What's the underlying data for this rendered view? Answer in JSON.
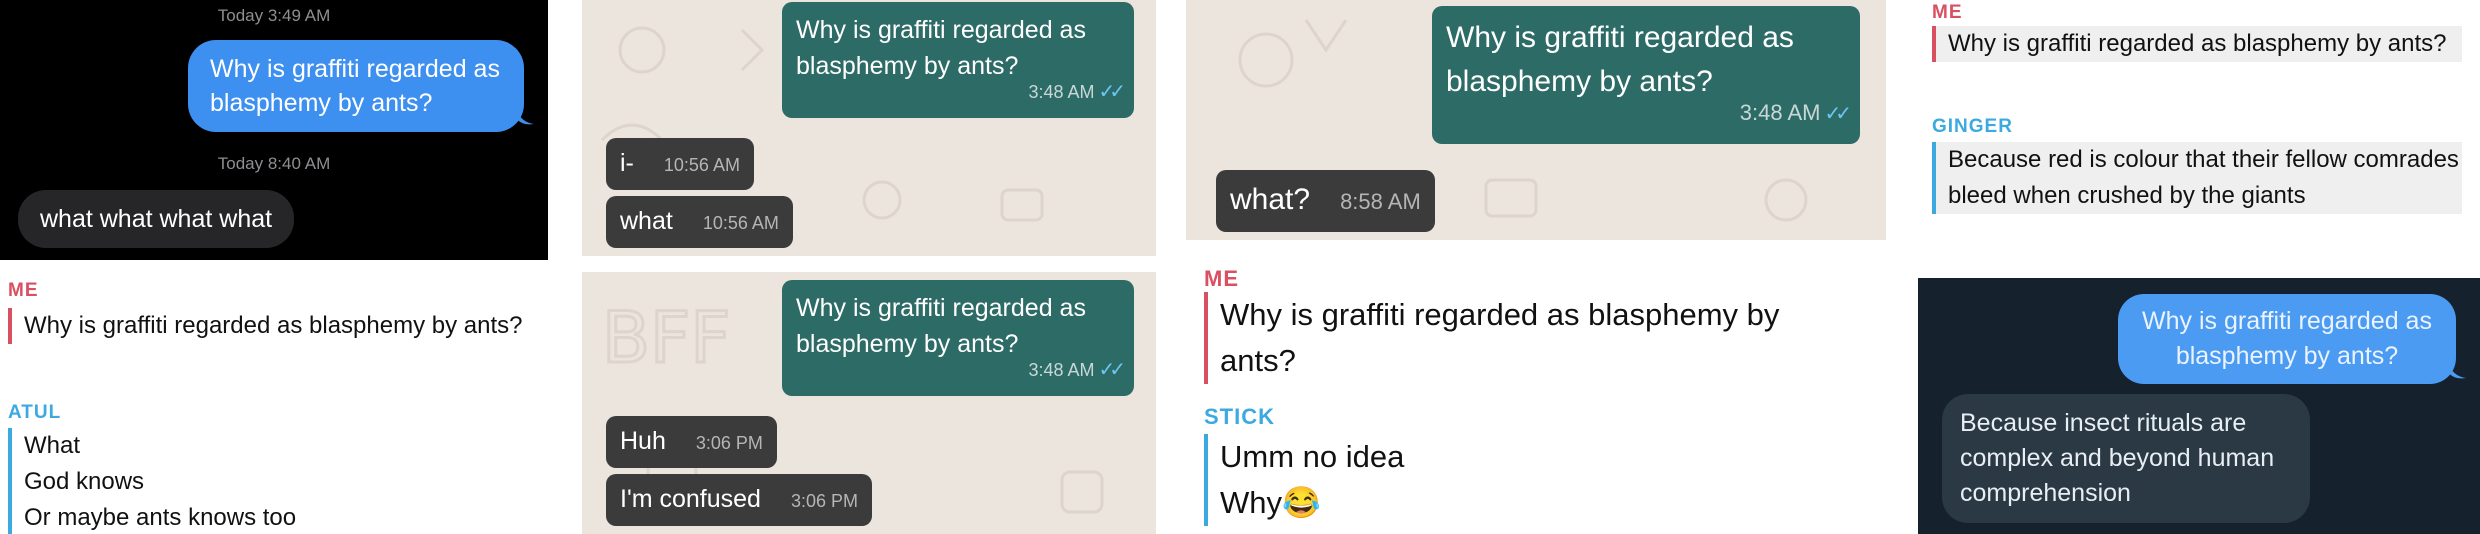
{
  "panel1": {
    "time1": "Today 3:49 AM",
    "out": "Why is graffiti regarded as blasphemy by ants?",
    "time2": "Today 8:40 AM",
    "in": "what what what what"
  },
  "panel2": {
    "out": "Why is graffiti regarded as blasphemy by ants?",
    "out_time": "3:48 AM",
    "in1": "i-",
    "in1_time": "10:56 AM",
    "in2": "what",
    "in2_time": "10:56 AM"
  },
  "panel3": {
    "out": "Why is graffiti regarded as blasphemy by ants?",
    "out_time": "3:48 AM",
    "in1": "what?",
    "in1_time": "8:58 AM"
  },
  "panel4": {
    "me": "ME",
    "q": "Why is graffiti regarded as blasphemy by ants?",
    "name": "GINGER",
    "a": "Because red is colour that their fellow comrades bleed when crushed by the giants"
  },
  "panel5": {
    "me": "ME",
    "q": "Why is graffiti regarded as blasphemy by ants?",
    "name": "ATUL",
    "a1": "What",
    "a2": "God knows",
    "a3": "Or maybe ants knows too"
  },
  "panel6": {
    "out": "Why is graffiti regarded as blasphemy by ants?",
    "out_time": "3:48 AM",
    "in1": "Huh",
    "in1_time": "3:06 PM",
    "in2": "I'm confused",
    "in2_time": "3:06 PM"
  },
  "panel7": {
    "me": "ME",
    "q": "Why is graffiti regarded as blasphemy by ants?",
    "name": "STICK",
    "a1": "Umm no idea",
    "a2": "Why",
    "emoji": "😂"
  },
  "panel8": {
    "out": "Why is graffiti regarded as blasphemy by ants?",
    "in": "Because insect rituals are complex and beyond human comprehension"
  },
  "colors": {
    "me_red": "#d95061",
    "other_blue": "#3ca9e0",
    "imessage_blue": "#3d8ff0",
    "whatsapp_green": "#2d6b67",
    "navy_bg": "#15222e"
  }
}
